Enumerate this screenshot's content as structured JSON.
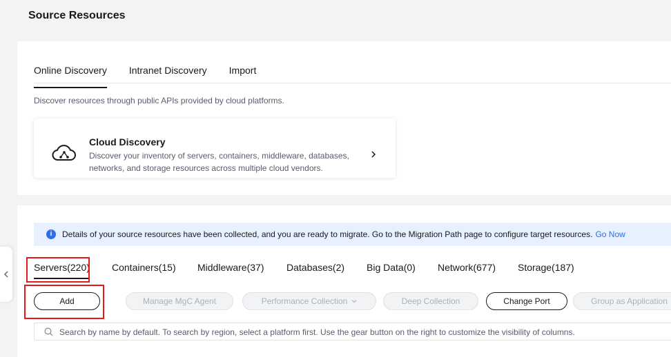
{
  "page": {
    "title": "Source Resources"
  },
  "discovery": {
    "tabs": [
      {
        "label": "Online Discovery",
        "active": true
      },
      {
        "label": "Intranet Discovery",
        "active": false
      },
      {
        "label": "Import",
        "active": false
      }
    ],
    "description": "Discover resources through public APIs provided by cloud platforms.",
    "cloud_card": {
      "icon": "cloud-network-icon",
      "title": "Cloud Discovery",
      "description": "Discover your inventory of servers, containers, middleware, databases, networks, and storage resources across multiple cloud vendors."
    }
  },
  "resources": {
    "banner": {
      "text": "Details of your source resources have been collected, and you are ready to migrate. Go to the Migration Path page to configure target resources.",
      "link": "Go Now"
    },
    "tabs": [
      {
        "label": "Servers(220)",
        "active": true
      },
      {
        "label": "Containers(15)",
        "active": false
      },
      {
        "label": "Middleware(37)",
        "active": false
      },
      {
        "label": "Databases(2)",
        "active": false
      },
      {
        "label": "Big Data(0)",
        "active": false
      },
      {
        "label": "Network(677)",
        "active": false
      },
      {
        "label": "Storage(187)",
        "active": false
      }
    ],
    "toolbar": {
      "add": "Add",
      "manage_agent": "Manage MgC Agent",
      "performance_collection": "Performance Collection",
      "deep_collection": "Deep Collection",
      "change_port": "Change Port",
      "group_as_application": "Group as Application"
    },
    "search": {
      "placeholder": "Search by name by default. To search by region, select a platform first. Use the gear button on the right to customize the visibility of columns.",
      "value": ""
    }
  },
  "colors": {
    "accent": "#2f6ee5",
    "highlight": "#e5191a",
    "banner_bg": "#e6f0ff"
  }
}
